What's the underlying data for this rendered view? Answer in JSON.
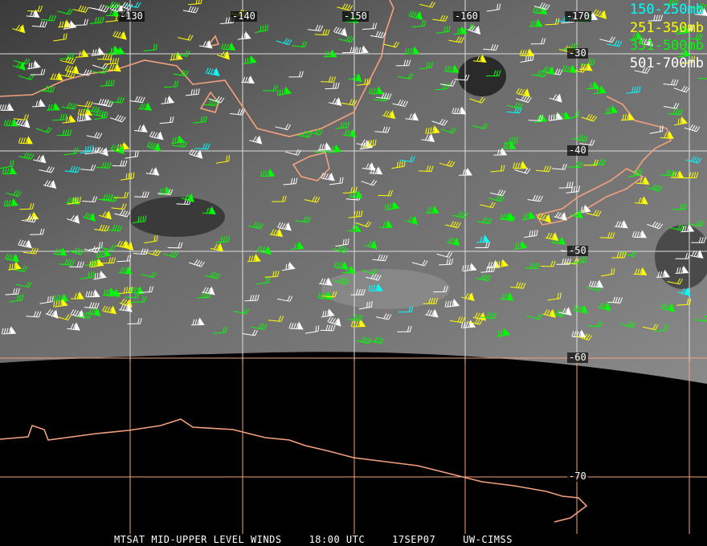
{
  "longitude_labels": [
    "-130",
    "-140",
    "-150",
    "-160",
    "-170"
  ],
  "latitude_labels": [
    "-30",
    "-40",
    "-50",
    "-60",
    "-70"
  ],
  "legend": [
    {
      "label": "150-250mb",
      "color": "#00ffff"
    },
    {
      "label": "251-350mb",
      "color": "#ffff00"
    },
    {
      "label": "351-500mb",
      "color": "#00ff00"
    },
    {
      "label": "501-700mb",
      "color": "#ffffff"
    }
  ],
  "footer": {
    "product": "MTSAT MID-UPPER LEVEL WINDS",
    "time": "18:00 UTC",
    "date": "17SEP07",
    "source": "UW-CIMSS"
  },
  "colors": {
    "coastline": "#f4a17e",
    "grid_ocean": "#dddddd",
    "grid_land": "#f4a17e"
  }
}
